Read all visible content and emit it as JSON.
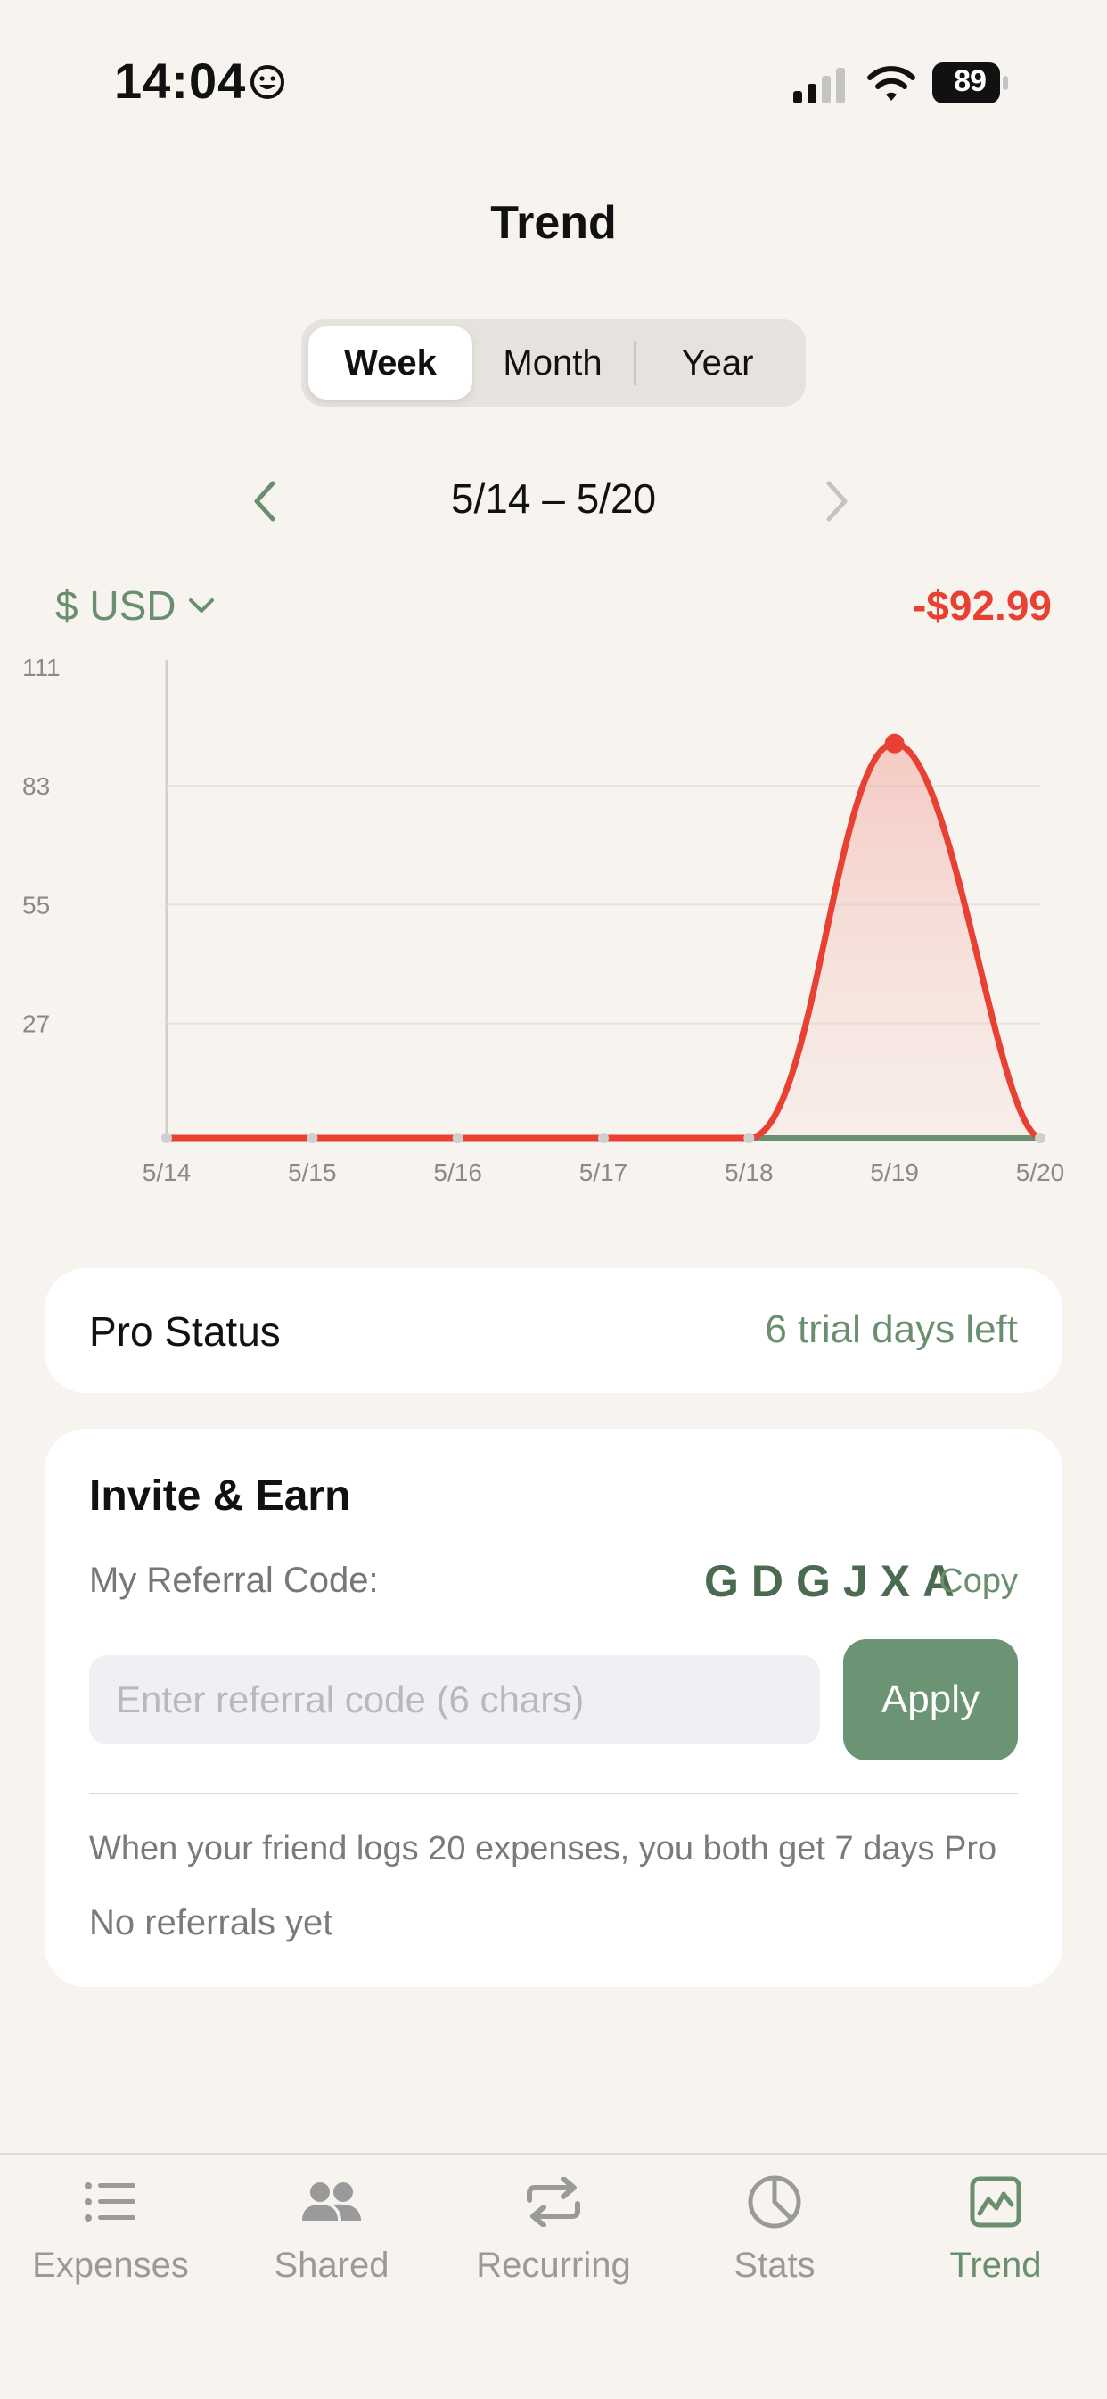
{
  "status_bar": {
    "time": "14:04",
    "battery": "89"
  },
  "header": {
    "title": "Trend"
  },
  "period_tabs": [
    {
      "label": "Week",
      "active": true
    },
    {
      "label": "Month",
      "active": false
    },
    {
      "label": "Year",
      "active": false
    }
  ],
  "date_nav": {
    "range": "5/14 – 5/20"
  },
  "currency": {
    "label": "$ USD"
  },
  "total": "-$92.99",
  "colors": {
    "accent_green": "#6a8f6e",
    "expense_red": "#e84133",
    "background": "#f7f4ef"
  },
  "chart_data": {
    "type": "area",
    "categories": [
      "5/14",
      "5/15",
      "5/16",
      "5/17",
      "5/18",
      "5/19",
      "5/20"
    ],
    "y_ticks": [
      "111",
      "83",
      "55",
      "27"
    ],
    "ylim": [
      0,
      111
    ],
    "series": [
      {
        "values": [
          0,
          0,
          0,
          0,
          0,
          92.99,
          0
        ],
        "color": "#e84133"
      },
      {
        "values": [
          0,
          0,
          0,
          0,
          0,
          0,
          0
        ],
        "color": "#6a8f6e"
      }
    ],
    "grid": true
  },
  "pro_status": {
    "label": "Pro Status",
    "value": "6 trial days left"
  },
  "invite": {
    "title": "Invite & Earn",
    "code_label": "My Referral Code:",
    "code": "GDGJXA",
    "copy_label": "Copy",
    "input_placeholder": "Enter referral code (6 chars)",
    "apply_label": "Apply",
    "info": "When your friend logs 20 expenses, you both get 7 days Pro",
    "referrals_status": "No referrals yet"
  },
  "tabbar": [
    {
      "label": "Expenses",
      "icon": "list-icon",
      "active": false
    },
    {
      "label": "Shared",
      "icon": "people-icon",
      "active": false
    },
    {
      "label": "Recurring",
      "icon": "repeat-icon",
      "active": false
    },
    {
      "label": "Stats",
      "icon": "pie-chart-icon",
      "active": false
    },
    {
      "label": "Trend",
      "icon": "trend-chart-icon",
      "active": true
    }
  ]
}
